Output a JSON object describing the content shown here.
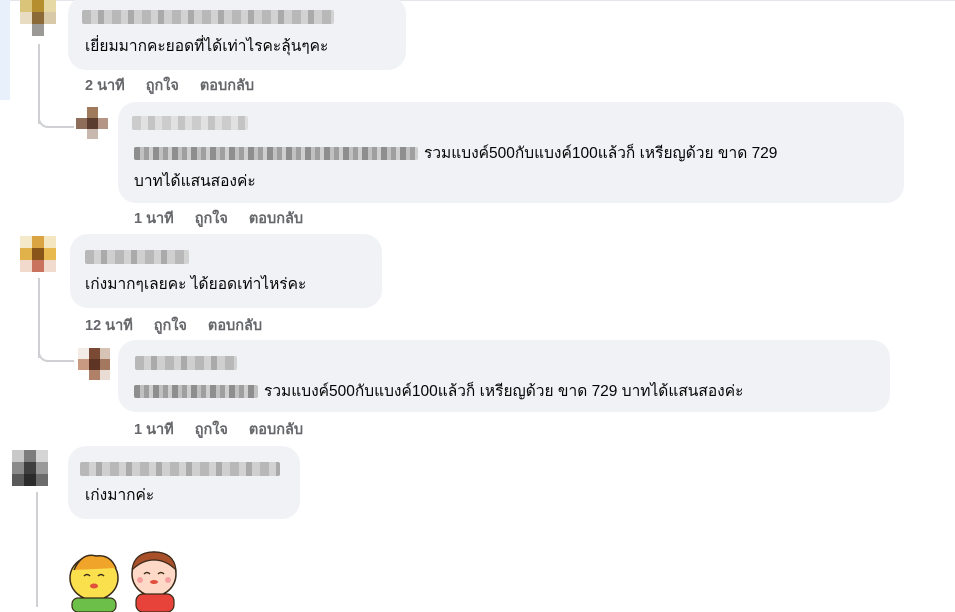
{
  "comments": [
    {
      "text": "เยี่ยมมากคะยอดที่ได้เท่าไรคะลุ้นๆคะ",
      "time": "2 นาที",
      "like_label": "ถูกใจ",
      "reply_label": "ตอบกลับ",
      "reply": {
        "text_line1": "รวมแบงค์500กับแบงค์100แล้วก็ เหรียญด้วย ขาด 729",
        "text_line2": "บาทได้แสนสองค่ะ",
        "time": "1 นาที",
        "like_label": "ถูกใจ",
        "reply_label": "ตอบกลับ"
      }
    },
    {
      "text": "เก่งมากๆเลยคะ ได้ยอดเท่าไหร่คะ",
      "time": "12 นาที",
      "like_label": "ถูกใจ",
      "reply_label": "ตอบกลับ",
      "reply": {
        "text": "รวมแบงค์500กับแบงค์100แล้วก็ เหรียญด้วย ขาด 729 บาทได้แสนสองค่ะ",
        "time": "1 นาที",
        "like_label": "ถูกใจ",
        "reply_label": "ตอบกลับ"
      }
    },
    {
      "text": "เก่งมากค่ะ"
    }
  ],
  "colors": {
    "bubble_bg": "#f0f2f5",
    "meta_text": "#65676b",
    "thread_line": "#ced0d4"
  }
}
